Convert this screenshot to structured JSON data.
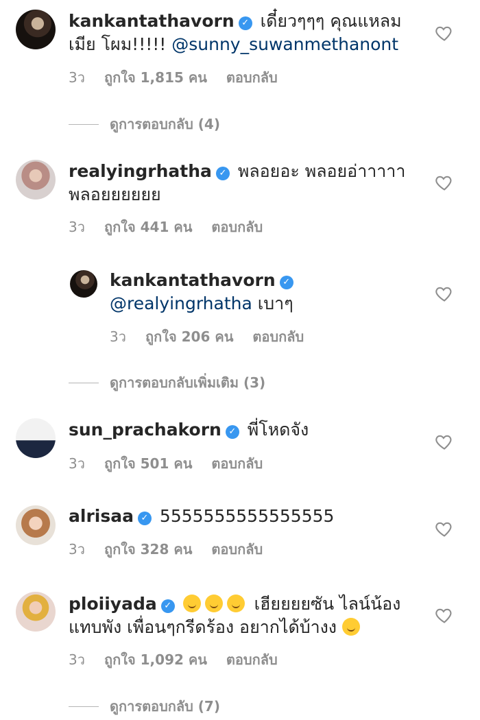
{
  "comments": [
    {
      "username": "kankantathavorn",
      "text": "เดี๋ยวๆๆๆ คุณแหลมเมีย โผม!!!!!",
      "mention": "@sunny_suwanmethanont",
      "time": "3ว",
      "likes": "ถูกใจ 1,815 คน",
      "reply": "ตอบกลับ",
      "view_replies": "ดูการตอบกลับ (4)"
    },
    {
      "username": "realyingrhatha",
      "text": "พลอยอะ พลอยอ่าาาาา พลอยยยยยย",
      "time": "3ว",
      "likes": "ถูกใจ 441 คน",
      "reply": "ตอบกลับ",
      "nested": {
        "username": "kankantathavorn",
        "mention": "@realyingrhatha",
        "text": "เบาๆ",
        "time": "3ว",
        "likes": "ถูกใจ 206 คน",
        "reply": "ตอบกลับ"
      },
      "view_replies": "ดูการตอบกลับเพิ่มเติม (3)"
    },
    {
      "username": "sun_prachakorn",
      "text": "พี่โหดจัง",
      "time": "3ว",
      "likes": "ถูกใจ 501 คน",
      "reply": "ตอบกลับ"
    },
    {
      "username": "alrisaa",
      "text": "5555555555555555",
      "time": "3ว",
      "likes": "ถูกใจ 328 คน",
      "reply": "ตอบกลับ"
    },
    {
      "username": "ploiiyada",
      "text_line1": "เฮียยยยซัน ไลน์น้อง",
      "text_line2": "แทบพัง เพื่อนๆกรีดร้อง อยากได้บ้างง",
      "time": "3ว",
      "likes": "ถูกใจ 1,092 คน",
      "reply": "ตอบกลับ",
      "view_replies": "ดูการตอบกลับ (7)"
    }
  ],
  "colors": {
    "verified_badge": "#3897f0",
    "mention": "#003569",
    "meta_text": "#8e8e8e"
  },
  "icons": {
    "verified": "verified-badge-icon",
    "like": "heart-outline-icon"
  }
}
